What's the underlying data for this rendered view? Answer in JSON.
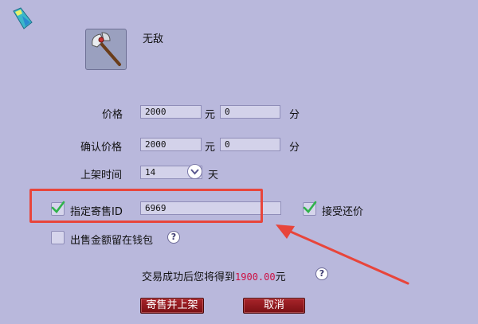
{
  "item": {
    "name": "无敌",
    "icon": "battle-axe-icon",
    "corner_icon": "gem-icon"
  },
  "form": {
    "price_label": "价格",
    "price_yuan": "2000",
    "price_fen": "0",
    "confirm_label": "确认价格",
    "confirm_yuan": "2000",
    "confirm_fen": "0",
    "yuan_unit": "元",
    "fen_unit": "分",
    "listing_label": "上架时间",
    "listing_value": "14",
    "listing_unit": "天",
    "designated_label": "指定寄售ID",
    "designated_checked": true,
    "designated_id": "6969",
    "accept_counter_label": "接受还价",
    "accept_counter_checked": true,
    "keep_in_wallet_label": "出售金额留在钱包",
    "keep_in_wallet_checked": false
  },
  "summary": {
    "prefix": "交易成功后您将得到",
    "amount": "1900.00",
    "suffix": "元"
  },
  "buttons": {
    "submit": "寄售并上架",
    "cancel": "取消"
  },
  "colors": {
    "background": "#b9b8dc",
    "highlight_box": "#e8453b",
    "amount": "#cc1144",
    "button": "#8e1a1f",
    "check_mark": "#2fb34a"
  }
}
